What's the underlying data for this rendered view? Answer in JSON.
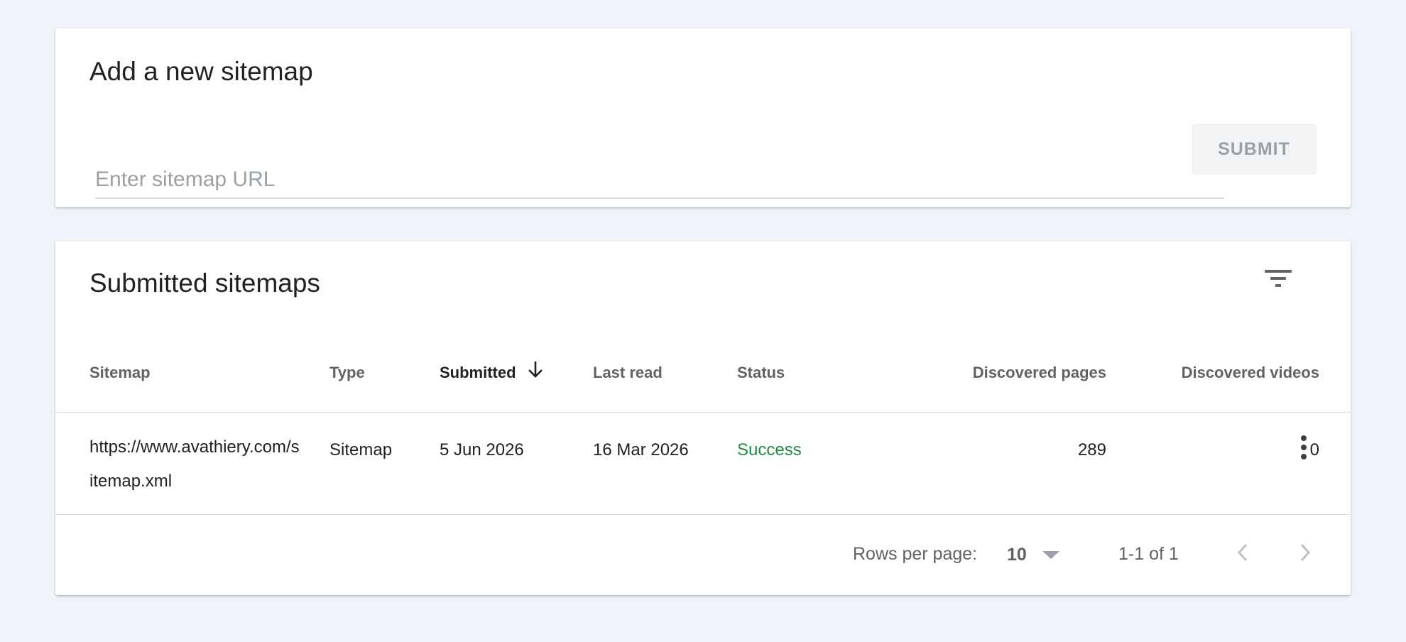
{
  "add_sitemap": {
    "title": "Add a new sitemap",
    "url_placeholder": "Enter sitemap URL",
    "url_value": "",
    "submit_label": "SUBMIT"
  },
  "submitted": {
    "title": "Submitted sitemaps",
    "columns": [
      "Sitemap",
      "Type",
      "Submitted",
      "Last read",
      "Status",
      "Discovered pages",
      "Discovered videos"
    ],
    "sorted_column": "Submitted",
    "sort_direction": "descending",
    "rows": [
      {
        "sitemap": "https://www.avathiery.com/sitemap.xml",
        "type": "Sitemap",
        "submitted": "5 Jun 2026",
        "last_read": "16 Mar 2026",
        "status": "Success",
        "discovered_pages": "289",
        "discovered_videos": "0"
      }
    ]
  },
  "pagination": {
    "rows_per_page_label": "Rows per page:",
    "rows_per_page_value": "10",
    "range_text": "1-1 of 1"
  },
  "icons": {
    "filter": "filter-icon",
    "sort": "arrow-down-icon",
    "more": "more-vert-icon",
    "dropdown": "caret-down-icon",
    "prev": "chevron-left-icon",
    "next": "chevron-right-icon"
  },
  "colors": {
    "page_bg": "#f0f4fa",
    "success": "#1e8e3e",
    "muted_text": "#5f6368",
    "disabled_text": "#9aa0a6"
  }
}
